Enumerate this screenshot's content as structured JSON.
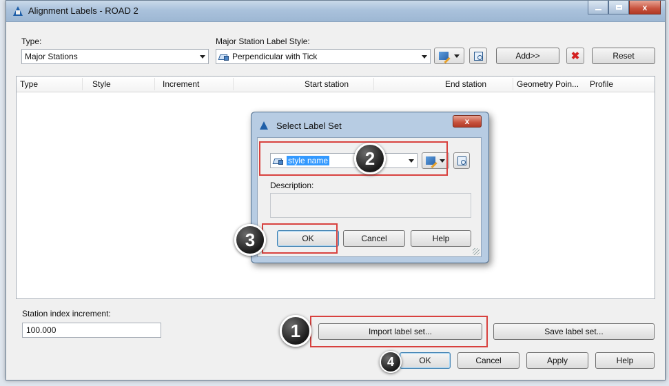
{
  "window": {
    "title": "Alignment Labels - ROAD 2",
    "close_glyph": "x"
  },
  "type_field": {
    "label": "Type:",
    "value": "Major Stations"
  },
  "style_field": {
    "label": "Major Station Label Style:",
    "value": "Perpendicular with Tick"
  },
  "toolbar": {
    "add_label": "Add>>",
    "reset_label": "Reset"
  },
  "table": {
    "columns": [
      "Type",
      "Style",
      "Increment",
      "Start station",
      "End station",
      "Geometry Poin...",
      "Profile"
    ]
  },
  "station_index": {
    "label": "Station index increment:",
    "value": "100.000"
  },
  "bottom_buttons": {
    "import_label": "Import label set...",
    "save_label": "Save label set...",
    "ok": "OK",
    "cancel": "Cancel",
    "apply": "Apply",
    "help": "Help"
  },
  "dialog": {
    "title": "Select Label Set",
    "close_glyph": "x",
    "style_value": "style name",
    "description_label": "Description:",
    "description_value": "",
    "ok": "OK",
    "cancel": "Cancel",
    "help": "Help"
  },
  "annotations": {
    "step1": "1",
    "step2": "2",
    "step3": "3",
    "step4": "4",
    "highlight_color": "#d8413e"
  },
  "icons": [
    "autocad-logo-icon",
    "minimize-icon",
    "maximize-icon",
    "close-icon",
    "label-style-icon",
    "edit-style-icon",
    "preview-style-icon",
    "delete-icon",
    "chevron-down-icon",
    "resize-grip-icon"
  ]
}
